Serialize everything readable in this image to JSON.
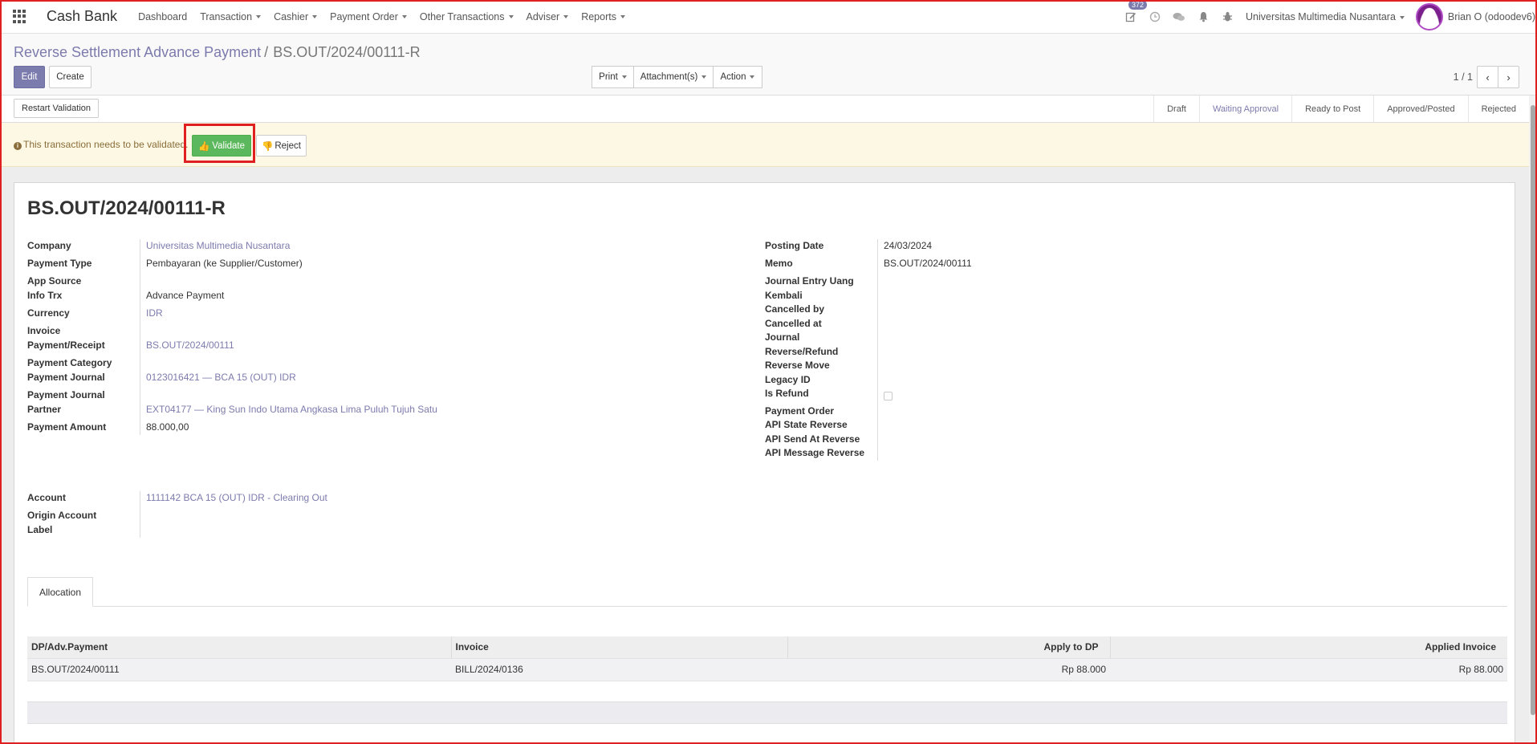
{
  "navbar": {
    "app_title": "Cash Bank",
    "menu": [
      {
        "label": "Dashboard",
        "dropdown": false
      },
      {
        "label": "Transaction",
        "dropdown": true
      },
      {
        "label": "Cashier",
        "dropdown": true
      },
      {
        "label": "Payment Order",
        "dropdown": true
      },
      {
        "label": "Other Transactions",
        "dropdown": true
      },
      {
        "label": "Adviser",
        "dropdown": true
      },
      {
        "label": "Reports",
        "dropdown": true
      }
    ],
    "activity_badge": "372",
    "company": "Universitas Multimedia Nusantara",
    "user": "Brian O (odoodev6)"
  },
  "breadcrumb": {
    "parent": "Reverse Settlement Advance Payment",
    "separator": "/",
    "current": "BS.OUT/2024/00111-R"
  },
  "buttons": {
    "edit": "Edit",
    "create": "Create",
    "print": "Print",
    "attachments": "Attachment(s)",
    "action": "Action",
    "restart_validation": "Restart Validation",
    "validate": "Validate",
    "reject": "Reject"
  },
  "pager": {
    "value": "1 / 1"
  },
  "stages": [
    "Draft",
    "Waiting Approval",
    "Ready to Post",
    "Approved/Posted",
    "Rejected"
  ],
  "active_stage": "Waiting Approval",
  "alert": {
    "message": "This transaction needs to be validated."
  },
  "record": {
    "title": "BS.OUT/2024/00111-R",
    "left_fields": {
      "company": {
        "label": "Company",
        "value": "Universitas Multimedia Nusantara"
      },
      "payment_type": {
        "label": "Payment Type",
        "value": "Pembayaran (ke Supplier/Customer)"
      },
      "app_source": {
        "label": "App Source",
        "value": ""
      },
      "info_trx": {
        "label": "Info Trx",
        "value": "Advance Payment"
      },
      "currency": {
        "label": "Currency",
        "value": "IDR"
      },
      "invoice_payment": {
        "label_1": "Invoice",
        "label_2": "Payment/Receipt",
        "value": "BS.OUT/2024/00111"
      },
      "payment_category": {
        "label": "Payment Category",
        "value": ""
      },
      "payment_journal": {
        "label": "Payment Journal",
        "value": "0123016421 — BCA 15 (OUT) IDR"
      },
      "journal_partner": {
        "label_1": "Payment Journal",
        "label_2": "Partner",
        "value": "EXT04177 — King Sun Indo Utama Angkasa Lima Puluh Tujuh Satu"
      },
      "payment_amount": {
        "label": "Payment Amount",
        "value": "88.000,00"
      }
    },
    "right_fields": {
      "posting_date": {
        "label": "Posting Date",
        "value": "24/03/2024"
      },
      "memo": {
        "label": "Memo",
        "value": "BS.OUT/2024/00111"
      },
      "journal_entry": {
        "label_1": "Journal Entry Uang",
        "label_2": "Kembali"
      },
      "cancelled_by": {
        "label": "Cancelled by"
      },
      "cancelled_at": {
        "label": "Cancelled at"
      },
      "journal": {
        "label": "Journal"
      },
      "reverse_refund": {
        "label": "Reverse/Refund"
      },
      "reverse_move": {
        "label": "Reverse Move"
      },
      "legacy_id": {
        "label": "Legacy ID"
      },
      "is_refund": {
        "label": "Is Refund",
        "checked": false
      },
      "payment_order": {
        "label": "Payment Order"
      },
      "api_state": {
        "label": "API State Reverse"
      },
      "api_send": {
        "label": "API Send At Reverse"
      },
      "api_message": {
        "label": "API Message Reverse"
      }
    },
    "account": {
      "label": "Account",
      "value": "1111142 BCA 15 (OUT) IDR - Clearing Out"
    },
    "origin_account": {
      "label_1": "Origin Account",
      "label_2": "Label",
      "value": ""
    }
  },
  "allocation": {
    "tab_label": "Allocation",
    "columns": [
      "DP/Adv.Payment",
      "Invoice",
      "Apply to DP",
      "Applied Invoice"
    ],
    "rows": [
      [
        "BS.OUT/2024/00111",
        "BILL/2024/0136",
        "Rp 88.000",
        "Rp 88.000"
      ]
    ]
  }
}
